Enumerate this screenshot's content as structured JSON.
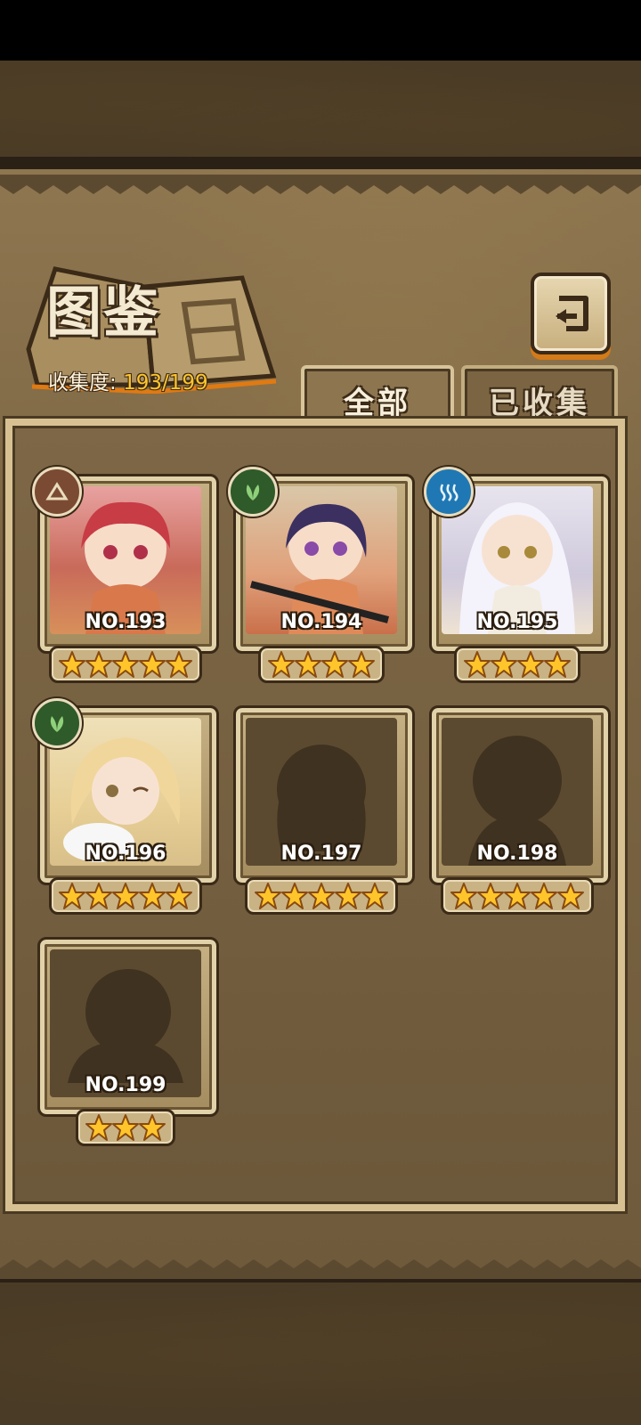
{
  "header": {
    "title": "图鉴",
    "collection_label": "收集度:",
    "collection_value": "193/199"
  },
  "tabs": [
    {
      "label": "全部",
      "active": true
    },
    {
      "label": "已收集",
      "active": false
    }
  ],
  "cards": [
    {
      "number": "NO.193",
      "stars": 5,
      "element": "earth-icon",
      "collected": true
    },
    {
      "number": "NO.194",
      "stars": 4,
      "element": "leaf-icon",
      "collected": true
    },
    {
      "number": "NO.195",
      "stars": 4,
      "element": "water-icon",
      "collected": true
    },
    {
      "number": "NO.196",
      "stars": 5,
      "element": "leaf-icon",
      "collected": true
    },
    {
      "number": "NO.197",
      "stars": 5,
      "element": null,
      "collected": false
    },
    {
      "number": "NO.198",
      "stars": 5,
      "element": null,
      "collected": false
    },
    {
      "number": "NO.199",
      "stars": 3,
      "element": null,
      "collected": false
    }
  ],
  "colors": {
    "accent": "#ffc52a",
    "parchment": "#7d6746",
    "frame": "#d7c193",
    "button_shadow": "#d47a18"
  }
}
